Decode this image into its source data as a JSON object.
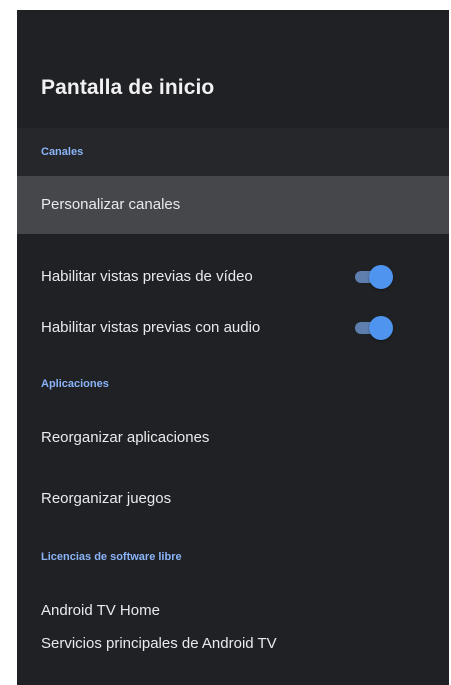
{
  "header": {
    "title": "Pantalla de inicio"
  },
  "sections": [
    {
      "label": "Canales",
      "items": [
        {
          "label": "Personalizar canales",
          "focused": true
        },
        {
          "label": "Habilitar vistas previas de vídeo",
          "toggle": true
        },
        {
          "label": "Habilitar vistas previas con audio",
          "toggle": true
        }
      ]
    },
    {
      "label": "Aplicaciones",
      "items": [
        {
          "label": "Reorganizar aplicaciones"
        },
        {
          "label": "Reorganizar juegos"
        }
      ]
    },
    {
      "label": "Licencias de software libre",
      "items": [
        {
          "label": "Android TV Home"
        },
        {
          "label": "Servicios principales de Android TV"
        }
      ]
    }
  ],
  "colors": {
    "background": "#202124",
    "focused_row": "#46474a",
    "section_header": "#8ab4f8",
    "toggle_on": "#4f94ee"
  }
}
